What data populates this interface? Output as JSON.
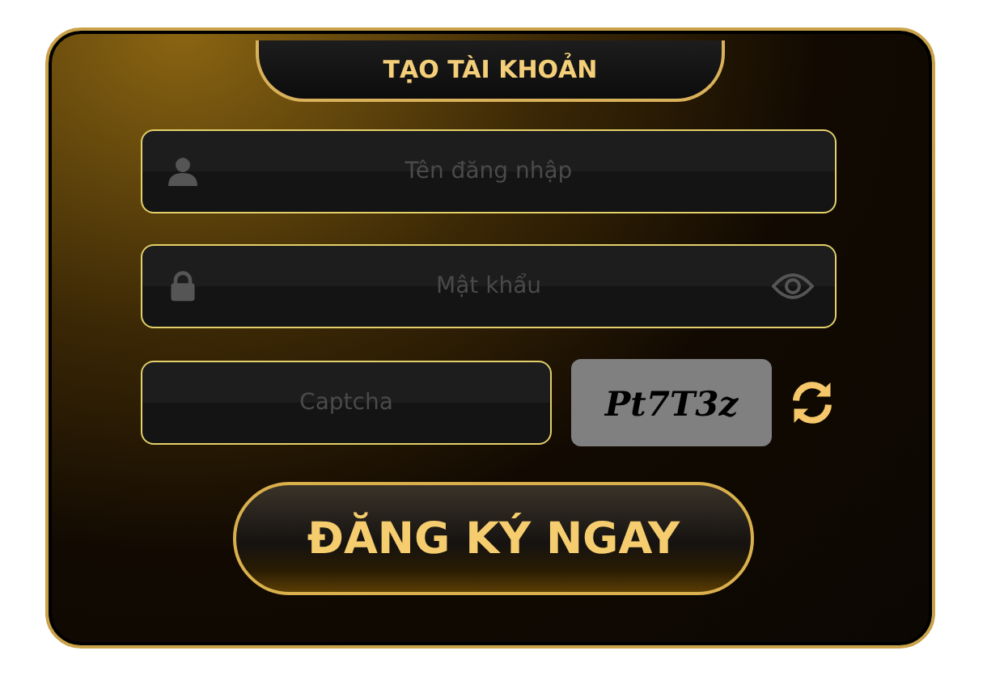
{
  "title": "TẠO TÀI KHOẢN",
  "fields": [
    {
      "kind": "username",
      "placeholder": "Tên đăng nhập"
    },
    {
      "kind": "password",
      "placeholder": "Mật khẩu"
    }
  ],
  "captcha": {
    "placeholder": "Captcha",
    "code": "Pt7T3z"
  },
  "submit": "ĐĂNG KÝ NGAY"
}
